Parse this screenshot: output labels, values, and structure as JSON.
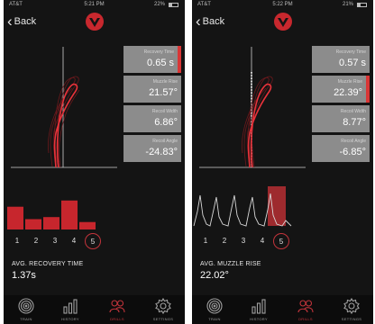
{
  "screens": [
    {
      "status": {
        "carrier": "AT&T",
        "time": "5:21 PM",
        "battery": "22%"
      },
      "back_label": "Back",
      "metrics": [
        {
          "label": "Recovery Time",
          "value": "0.65 s",
          "active": true
        },
        {
          "label": "Muzzle Rise",
          "value": "21.57°",
          "active": false
        },
        {
          "label": "Recoil Width",
          "value": "6.86°",
          "active": false
        },
        {
          "label": "Recoil Angle",
          "value": "-24.83°",
          "active": false
        }
      ],
      "shot_numbers": [
        "1",
        "2",
        "3",
        "4",
        "5"
      ],
      "selected_shot": "5",
      "avg_label": "AVG. RECOVERY TIME",
      "avg_value": "1.37s",
      "bar_values": [
        0.55,
        0.25,
        0.3,
        0.7,
        0.18
      ],
      "tabs": [
        "TRAIN",
        "HISTORY",
        "DRILLS",
        "SETTINGS"
      ],
      "active_tab": 2
    },
    {
      "status": {
        "carrier": "AT&T",
        "time": "5:22 PM",
        "battery": "21%"
      },
      "back_label": "Back",
      "metrics": [
        {
          "label": "Recovery Time",
          "value": "0.57 s",
          "active": false
        },
        {
          "label": "Muzzle Rise",
          "value": "22.39°",
          "active": true
        },
        {
          "label": "Recoil Width",
          "value": "8.77°",
          "active": false
        },
        {
          "label": "Recoil Angle",
          "value": "-6.85°",
          "active": false
        }
      ],
      "shot_numbers": [
        "1",
        "2",
        "3",
        "4",
        "5"
      ],
      "selected_shot": "5",
      "avg_label": "AVG. MUZZLE RISE",
      "avg_value": "22.02°",
      "tabs": [
        "TRAIN",
        "HISTORY",
        "DRILLS",
        "SETTINGS"
      ],
      "active_tab": 2
    }
  ]
}
